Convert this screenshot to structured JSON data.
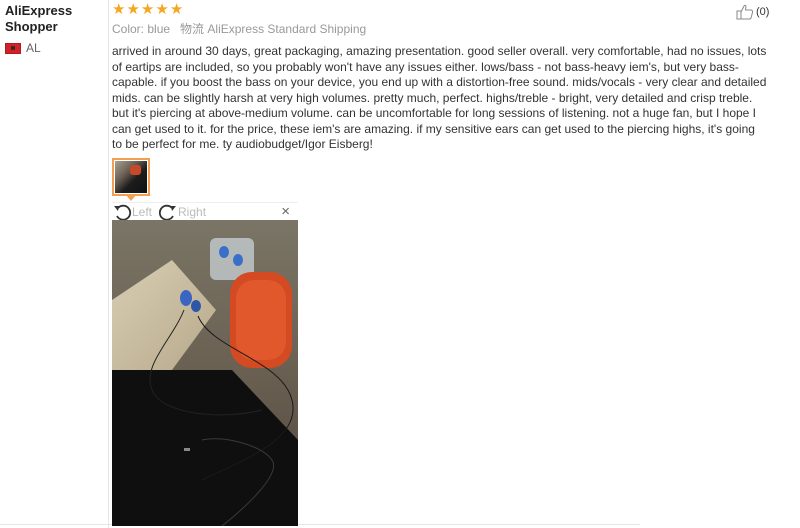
{
  "reviewer": {
    "name": "AliExpress Shopper",
    "country": "AL",
    "flag_color": "#d0202a"
  },
  "review": {
    "rating": 5,
    "stars": [
      "★",
      "★",
      "★",
      "★",
      "★"
    ],
    "star_color": "#f5a623",
    "color_label": "Color:",
    "color_value": "blue",
    "logistics_label": "物流",
    "logistics_value": "AliExpress Standard Shipping",
    "text": "arrived in around 30 days, great packaging, amazing presentation. good seller overall. very comfortable, had no issues, lots of eartips are included, so you probably won't have any issues either. lows/bass - not bass-heavy iem's, but very bass-capable. if you boost the bass on your device, you end up with a distortion-free sound. mids/vocals - very clear and detailed mids. can be slightly harsh at very high volumes. pretty much, perfect. highs/treble - bright, very detailed and crisp treble. but it's piercing at above-medium volume. can be uncomfortable for long sessions of listening. not a huge fan, but I hope I can get used to it. for the price, these iem's are amazing. if my sensitive ears can get used to the piercing highs, it's going to be perfect for me. ty audiobudget/Igor Eisberg!"
  },
  "helpful": {
    "count": "(0)",
    "icon": "thumbs-up-icon"
  },
  "viewer": {
    "rotate_left_label": "Left",
    "rotate_right_label": "Right",
    "close_label": "×",
    "thumbnail_border_color": "#f0a050"
  }
}
